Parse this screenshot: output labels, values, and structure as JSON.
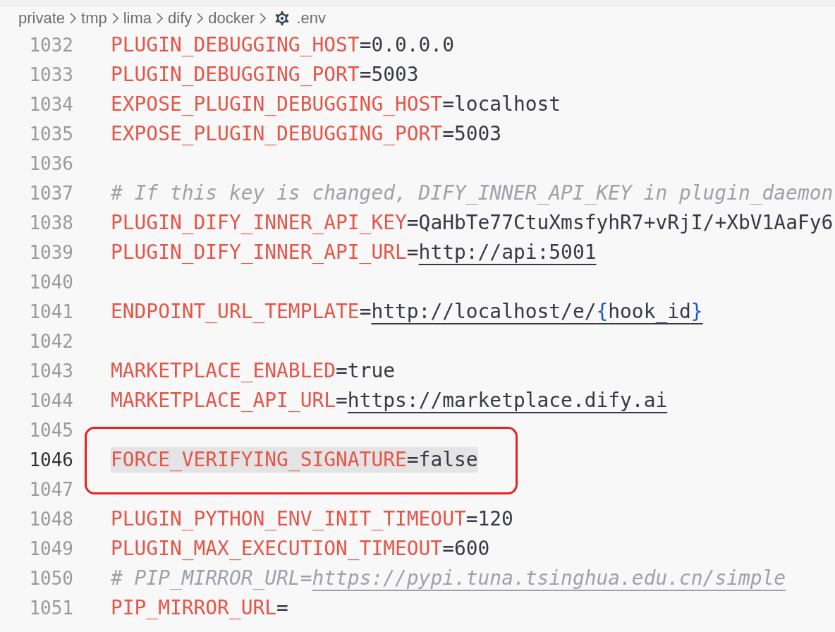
{
  "breadcrumb": [
    {
      "label": "private",
      "kind": "folder"
    },
    {
      "label": "tmp",
      "kind": "folder"
    },
    {
      "label": "lima",
      "kind": "folder"
    },
    {
      "label": "dify",
      "kind": "folder"
    },
    {
      "label": "docker",
      "kind": "folder"
    },
    {
      "label": ".env",
      "kind": "settings-file"
    }
  ],
  "lines": [
    {
      "number": "1032",
      "tokens": [
        {
          "text": "PLUGIN_DEBUGGING_HOST",
          "kind": "key"
        },
        {
          "text": "=0.0.0.0",
          "kind": "plain"
        }
      ]
    },
    {
      "number": "1033",
      "tokens": [
        {
          "text": "PLUGIN_DEBUGGING_PORT",
          "kind": "key"
        },
        {
          "text": "=5003",
          "kind": "plain"
        }
      ]
    },
    {
      "number": "1034",
      "tokens": [
        {
          "text": "EXPOSE_PLUGIN_DEBUGGING_HOST",
          "kind": "key"
        },
        {
          "text": "=localhost",
          "kind": "plain"
        }
      ]
    },
    {
      "number": "1035",
      "tokens": [
        {
          "text": "EXPOSE_PLUGIN_DEBUGGING_PORT",
          "kind": "key"
        },
        {
          "text": "=5003",
          "kind": "plain"
        }
      ]
    },
    {
      "number": "1036"
    },
    {
      "number": "1037",
      "tokens": [
        {
          "text": "# If this key is changed, DIFY_INNER_API_KEY in plugin_daemon",
          "kind": "comment"
        }
      ]
    },
    {
      "number": "1038",
      "tokens": [
        {
          "text": "PLUGIN_DIFY_INNER_API_KEY",
          "kind": "key"
        },
        {
          "text": "=QaHbTe77CtuXmsfyhR7+vRjI/+XbV1AaFy6",
          "kind": "plain"
        }
      ]
    },
    {
      "number": "1039",
      "tokens": [
        {
          "text": "PLUGIN_DIFY_INNER_API_URL",
          "kind": "key"
        },
        {
          "text": "=",
          "kind": "plain"
        },
        {
          "text": "http://api:5001",
          "kind": "url"
        }
      ]
    },
    {
      "number": "1040"
    },
    {
      "number": "1041",
      "tokens": [
        {
          "text": "ENDPOINT_URL_TEMPLATE",
          "kind": "key"
        },
        {
          "text": "=",
          "kind": "plain"
        },
        {
          "text": "http://localhost/e/",
          "kind": "url"
        },
        {
          "text": "{",
          "kind": "brace"
        },
        {
          "text": "hook_id",
          "kind": "url"
        },
        {
          "text": "}",
          "kind": "brace"
        }
      ]
    },
    {
      "number": "1042"
    },
    {
      "number": "1043",
      "tokens": [
        {
          "text": "MARKETPLACE_ENABLED",
          "kind": "key"
        },
        {
          "text": "=true",
          "kind": "plain"
        }
      ]
    },
    {
      "number": "1044",
      "tokens": [
        {
          "text": "MARKETPLACE_API_URL",
          "kind": "key"
        },
        {
          "text": "=",
          "kind": "plain"
        },
        {
          "text": "https://marketplace.dify.ai",
          "kind": "url"
        }
      ]
    },
    {
      "number": "1045"
    },
    {
      "number": "1046",
      "current": true,
      "highlighted": true,
      "annotated": true,
      "tokens": [
        {
          "text": "FORCE_VERIFYING_SIGNATURE",
          "kind": "key"
        },
        {
          "text": "=false",
          "kind": "plain"
        }
      ]
    },
    {
      "number": "1047"
    },
    {
      "number": "1048",
      "tokens": [
        {
          "text": "PLUGIN_PYTHON_ENV_INIT_TIMEOUT",
          "kind": "key"
        },
        {
          "text": "=120",
          "kind": "plain"
        }
      ]
    },
    {
      "number": "1049",
      "tokens": [
        {
          "text": "PLUGIN_MAX_EXECUTION_TIMEOUT",
          "kind": "key"
        },
        {
          "text": "=600",
          "kind": "plain"
        }
      ]
    },
    {
      "number": "1050",
      "tokens": [
        {
          "text": "# PIP_MIRROR_URL=",
          "kind": "comment"
        },
        {
          "text": "https://pypi.tuna.tsinghua.edu.cn/simple",
          "kind": "comment-url"
        }
      ]
    },
    {
      "number": "1051",
      "tokens": [
        {
          "text": "PIP_MIRROR_URL",
          "kind": "key"
        },
        {
          "text": "=",
          "kind": "plain"
        }
      ]
    }
  ]
}
